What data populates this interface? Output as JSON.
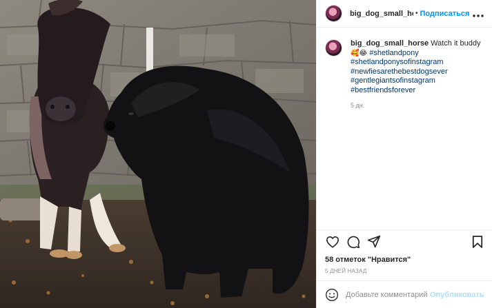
{
  "post": {
    "image_alt_subjects": [
      "miniature horse",
      "newfoundland dog"
    ],
    "header": {
      "username": "big_dog_small_horse",
      "separator": "•",
      "follow_label": "Подписаться",
      "more_icon": "more-horizontal-icon"
    },
    "caption": {
      "username": "big_dog_small_horse",
      "text": "Watch it buddy",
      "emojis": "🥰😂",
      "tags": [
        "#shetlandpony",
        "#shetlandponysofinstagram",
        "#newfiesarethebestdogsever",
        "#gentlegiantsofinstagram",
        "#bestfriendsforever"
      ],
      "time": "5 дн."
    },
    "actions": {
      "like_icon": "heart-icon",
      "comment_icon": "comment-icon",
      "share_icon": "share-icon",
      "save_icon": "bookmark-icon"
    },
    "likes_text": "58 отметок \"Нравится\"",
    "posted_ago": "5 ДНЕЙ НАЗАД",
    "comment_box": {
      "emoji_icon": "smile-icon",
      "placeholder": "Добавьте комментарий...",
      "post_label": "Опубликовать"
    },
    "colors": {
      "link_blue": "#0095f6",
      "hashtag": "#00376b",
      "muted": "#8e8e8e",
      "post_disabled": "#b2dffc"
    }
  }
}
